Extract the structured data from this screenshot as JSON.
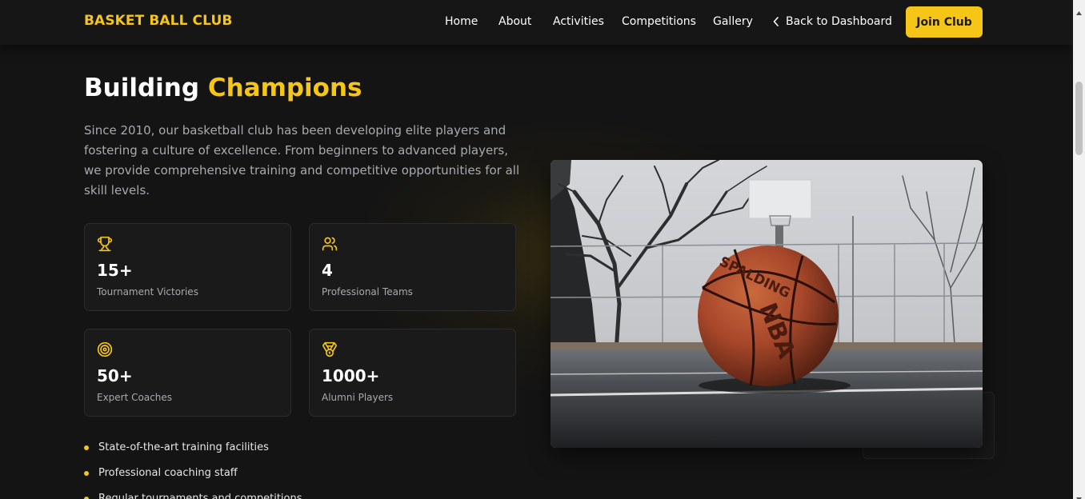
{
  "brand": "BASKET BALL CLUB",
  "nav": {
    "home": "Home",
    "about": "About",
    "activities": "Activities",
    "competitions": "Competitions",
    "gallery": "Gallery",
    "back": "Back to Dashboard",
    "join": "Join Club"
  },
  "hero": {
    "title_part1": "Building",
    "title_part2": "Champions",
    "description": "Since 2010, our basketball club has been developing elite players and fostering a culture of excellence. From beginners to advanced players, we provide comprehensive training and competitive opportunities for all skill levels."
  },
  "stats": [
    {
      "value": "15+",
      "label": "Tournament Victories",
      "icon": "trophy-icon"
    },
    {
      "value": "4",
      "label": "Professional Teams",
      "icon": "users-icon"
    },
    {
      "value": "50+",
      "label": "Expert Coaches",
      "icon": "target-icon"
    },
    {
      "value": "1000+",
      "label": "Alumni Players",
      "icon": "medal-icon"
    }
  ],
  "features": [
    "State-of-the-art training facilities",
    "Professional coaching staff",
    "Regular tournaments and competitions"
  ],
  "ball_print": {
    "brand": "SPALDING",
    "league": "NBA"
  },
  "colors": {
    "accent": "#f5c518",
    "background": "#141414",
    "card": "#1a1a1a"
  }
}
